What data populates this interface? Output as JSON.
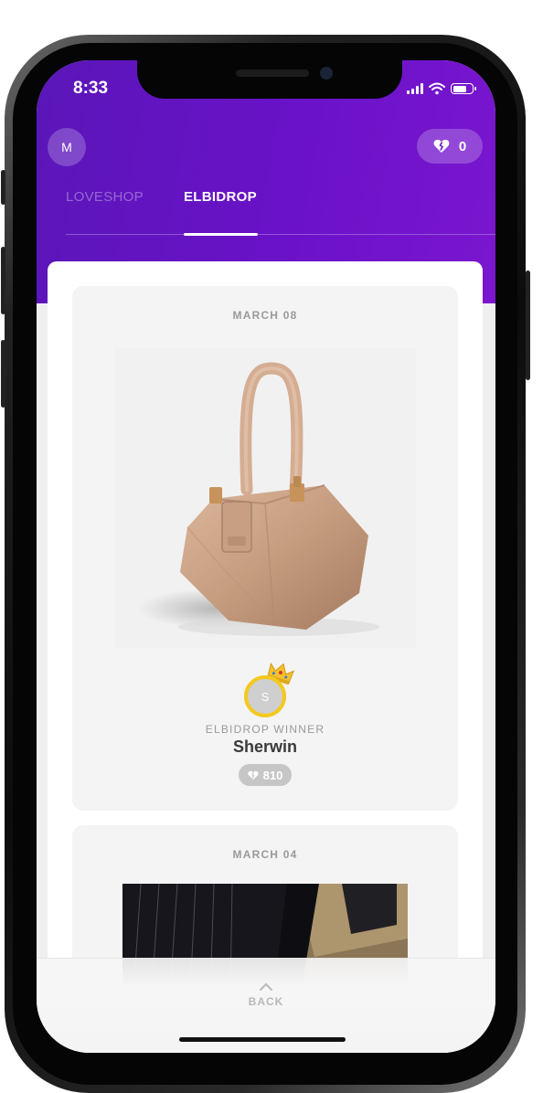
{
  "status_bar": {
    "time": "8:33"
  },
  "header": {
    "avatar_initial": "M",
    "hearts_count": "0"
  },
  "tabs": [
    {
      "label": "LOVESHOP",
      "active": false
    },
    {
      "label": "ELBIDROP",
      "active": true
    }
  ],
  "drops": [
    {
      "date": "MARCH 08",
      "product_image": "beige-leather-handbag",
      "winner": {
        "label": "ELBIDROP WINNER",
        "initial": "S",
        "name": "Sherwin",
        "hearts": "810"
      }
    },
    {
      "date": "MARCH 04",
      "product_image": "dark-striped-fabric-photo"
    }
  ],
  "bottom": {
    "back_label": "BACK"
  },
  "colors": {
    "accent_purple": "#6a12c8",
    "crown_gold": "#f3c91e",
    "muted_gray": "#9a9a9a"
  }
}
